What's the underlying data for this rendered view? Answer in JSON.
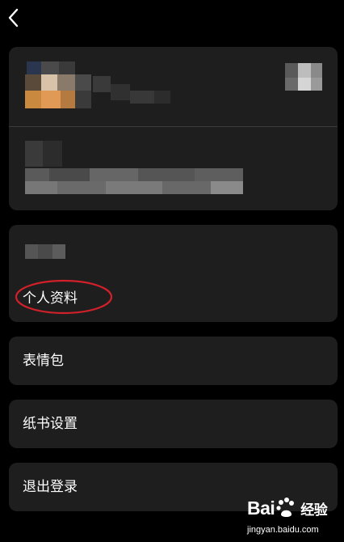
{
  "header": {
    "back_icon": "chevron-left-icon"
  },
  "account_info": {
    "items": [
      {
        "label": "个人资料"
      }
    ]
  },
  "menu": {
    "sticker": {
      "label": "表情包"
    },
    "paper_book_settings": {
      "label": "纸书设置"
    },
    "logout": {
      "label": "退出登录"
    }
  },
  "annotation": {
    "color": "#d0202a"
  },
  "watermark": {
    "brand": "Bai",
    "brand_cn": "经验",
    "url": "jingyan.baidu.com"
  },
  "colors": {
    "background": "#000000",
    "card": "#1e1e1e",
    "text": "#ffffff"
  }
}
